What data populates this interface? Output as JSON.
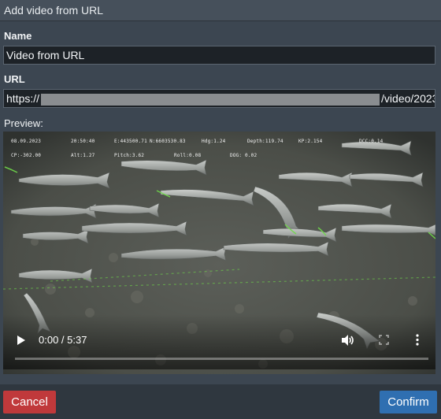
{
  "dialog": {
    "title": "Add video from URL"
  },
  "form": {
    "name_label": "Name",
    "name_value": "Video from URL",
    "url_label": "URL",
    "url_prefix": "https://",
    "url_suffix": "/video/2023",
    "preview_label": "Preview:"
  },
  "video": {
    "osd": {
      "date": "08.09.2023",
      "clock": "20:50:40",
      "easting": "E:443500.71",
      "northing": "N:6603530.83",
      "heading": "Hdg:1.24",
      "depth": "Depth:119.74",
      "kp": "KP:2.154",
      "dcc": "DCC:0.14",
      "cp": "CP:-302.00",
      "alt": "Alt:1.27",
      "pitch": "Pitch:3.62",
      "roll": "Roll:0.08",
      "dog": "DOG: 0.02"
    },
    "current_time": "0:00",
    "duration": "5:37",
    "time_display": "0:00 / 5:37",
    "progress_fraction": 0.0,
    "icons": {
      "play": "play-icon",
      "volume": "volume-icon",
      "fullscreen": "fullscreen-icon",
      "more": "more-options-icon"
    }
  },
  "actions": {
    "cancel_label": "Cancel",
    "confirm_label": "Confirm",
    "cancel_color": "#c0393b",
    "confirm_color": "#2f6fb1"
  }
}
